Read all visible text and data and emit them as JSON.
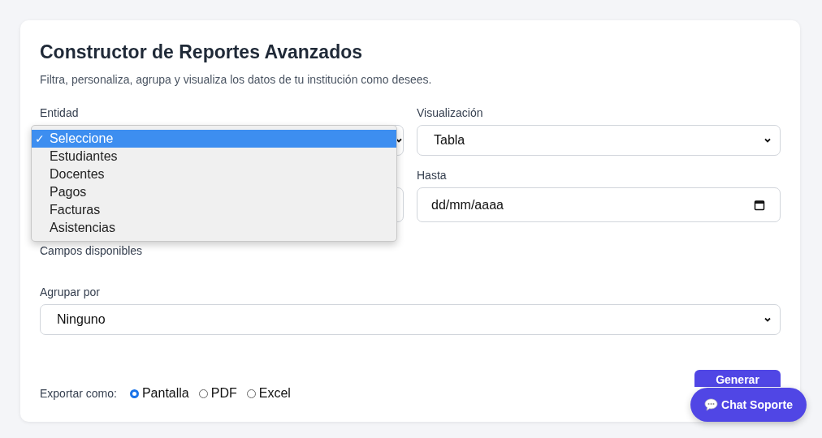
{
  "header": {
    "title": "Constructor de Reportes Avanzados",
    "subtitle": "Filtra, personaliza, agrupa y visualiza los datos de tu institución como desees."
  },
  "entity": {
    "label": "Entidad",
    "check_mark": "✓",
    "options": [
      {
        "label": "Seleccione",
        "selected": true
      },
      {
        "label": "Estudiantes",
        "selected": false
      },
      {
        "label": "Docentes",
        "selected": false
      },
      {
        "label": "Pagos",
        "selected": false
      },
      {
        "label": "Facturas",
        "selected": false
      },
      {
        "label": "Asistencias",
        "selected": false
      }
    ]
  },
  "visualization": {
    "label": "Visualización",
    "value": "Tabla"
  },
  "date_to": {
    "label": "Hasta",
    "placeholder": "dd/mm/aaaa"
  },
  "fields_label": "Campos disponibles",
  "group_by": {
    "label": "Agrupar por",
    "value": "Ninguno"
  },
  "export": {
    "label": "Exportar como:",
    "options": [
      {
        "label": "Pantalla",
        "selected": true
      },
      {
        "label": "PDF",
        "selected": false
      },
      {
        "label": "Excel",
        "selected": false
      }
    ]
  },
  "generate_button": "Generar",
  "chat_button": "Chat Soporte"
}
